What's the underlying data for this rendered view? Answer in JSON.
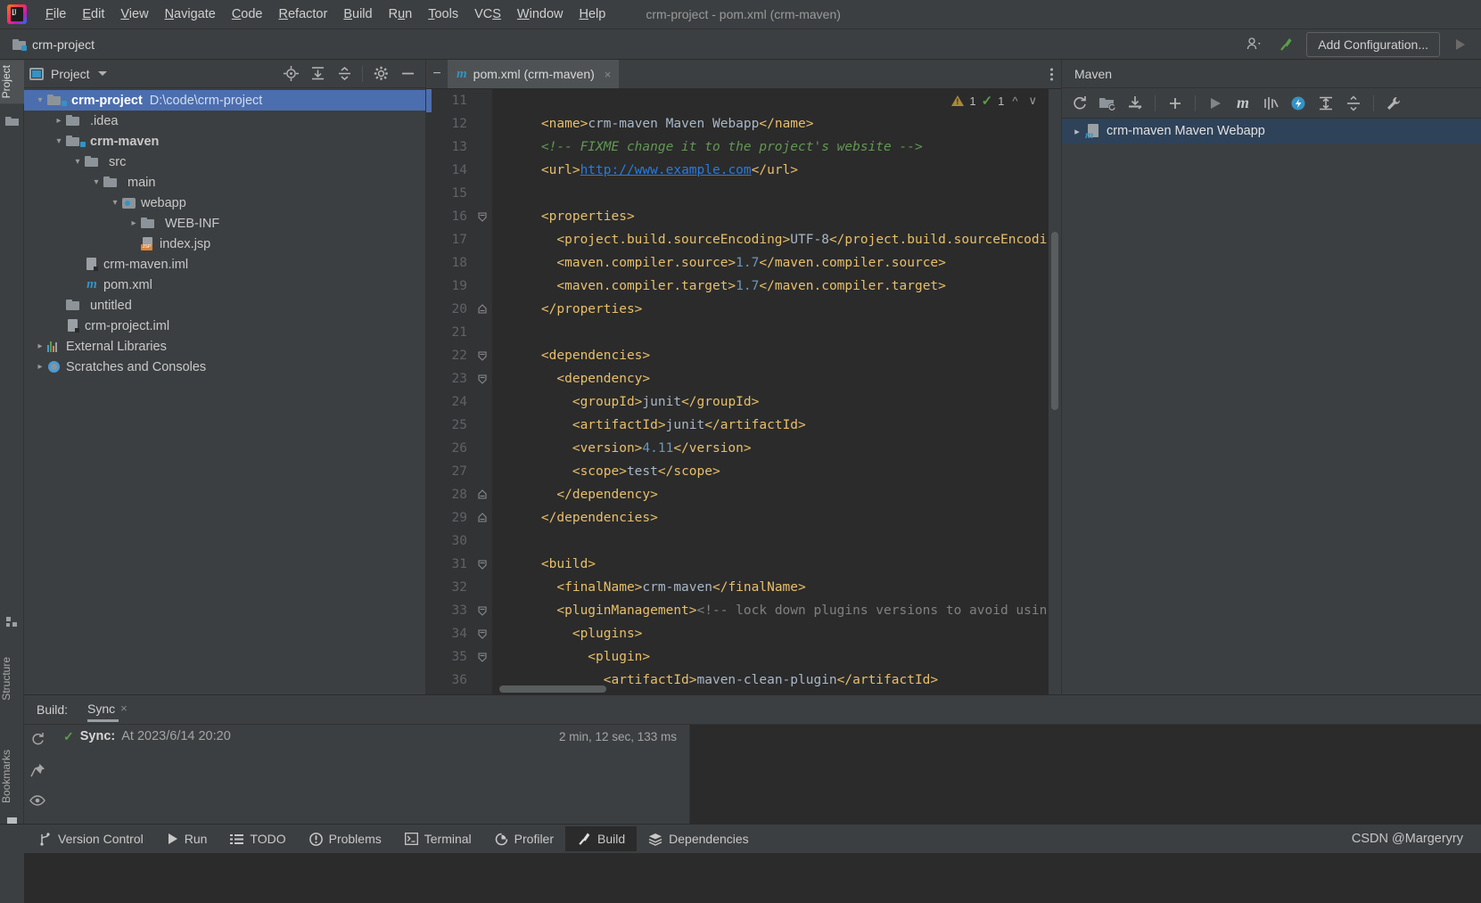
{
  "window": {
    "title": "crm-project - pom.xml (crm-maven)",
    "app_icon": "intellij-idea-logo"
  },
  "menu": {
    "items": [
      {
        "label": "File",
        "mnemonic": "F"
      },
      {
        "label": "Edit",
        "mnemonic": "E"
      },
      {
        "label": "View",
        "mnemonic": "V"
      },
      {
        "label": "Navigate",
        "mnemonic": "N"
      },
      {
        "label": "Code",
        "mnemonic": "C"
      },
      {
        "label": "Refactor",
        "mnemonic": "R"
      },
      {
        "label": "Build",
        "mnemonic": "B"
      },
      {
        "label": "Run",
        "mnemonic": "u"
      },
      {
        "label": "Tools",
        "mnemonic": "T"
      },
      {
        "label": "VCS",
        "mnemonic": "S"
      },
      {
        "label": "Window",
        "mnemonic": "W"
      },
      {
        "label": "Help",
        "mnemonic": "H"
      }
    ]
  },
  "navbar": {
    "breadcrumb": "crm-project",
    "add_configuration_label": "Add Configuration...",
    "icons": [
      "user-settings-icon",
      "hammer-build-icon",
      "run-triangle-icon"
    ]
  },
  "left_stripe": {
    "top_tabs": [
      {
        "label": "Project",
        "icon": "project-folder-icon",
        "active": true
      }
    ],
    "bottom_tabs": [
      {
        "label": "Structure",
        "icon": "structure-icon"
      },
      {
        "label": "Bookmarks",
        "icon": "bookmark-icon"
      }
    ]
  },
  "project_panel": {
    "title": "Project",
    "toolbar_icons": [
      "locate-target-icon",
      "expand-all-icon",
      "collapse-all-icon",
      "gear-icon",
      "hide-minus-icon"
    ],
    "tree": [
      {
        "indent": 0,
        "arrow": "down",
        "icon": "module-folder-icon",
        "label": "crm-project",
        "bold": true,
        "path": "D:\\code\\crm-project",
        "selected": true
      },
      {
        "indent": 1,
        "arrow": "right",
        "icon": "folder-icon",
        "label": ".idea",
        "bold": false,
        "path": "",
        "selected": false
      },
      {
        "indent": 1,
        "arrow": "down",
        "icon": "module-folder-icon",
        "label": "crm-maven",
        "bold": true,
        "path": "",
        "selected": false
      },
      {
        "indent": 2,
        "arrow": "down",
        "icon": "folder-icon",
        "label": "src",
        "bold": false,
        "path": "",
        "selected": false
      },
      {
        "indent": 3,
        "arrow": "down",
        "icon": "folder-icon",
        "label": "main",
        "bold": false,
        "path": "",
        "selected": false
      },
      {
        "indent": 4,
        "arrow": "down",
        "icon": "webapp-folder-icon",
        "label": "webapp",
        "bold": false,
        "path": "",
        "selected": false
      },
      {
        "indent": 5,
        "arrow": "right",
        "icon": "folder-icon",
        "label": "WEB-INF",
        "bold": false,
        "path": "",
        "selected": false
      },
      {
        "indent": 5,
        "arrow": "none",
        "icon": "jsp-file-icon",
        "label": "index.jsp",
        "bold": false,
        "path": "",
        "selected": false
      },
      {
        "indent": 2,
        "arrow": "none",
        "icon": "iml-file-icon",
        "label": "crm-maven.iml",
        "bold": false,
        "path": "",
        "selected": false
      },
      {
        "indent": 2,
        "arrow": "none",
        "icon": "maven-m-icon",
        "label": "pom.xml",
        "bold": false,
        "path": "",
        "selected": false
      },
      {
        "indent": 1,
        "arrow": "none",
        "icon": "folder-icon",
        "label": "untitled",
        "bold": false,
        "path": "",
        "selected": false
      },
      {
        "indent": 1,
        "arrow": "none",
        "icon": "iml-file-icon",
        "label": "crm-project.iml",
        "bold": false,
        "path": "",
        "selected": false
      },
      {
        "indent": 0,
        "arrow": "right",
        "icon": "external-libraries-icon",
        "label": "External Libraries",
        "bold": false,
        "path": "",
        "selected": false
      },
      {
        "indent": 0,
        "arrow": "right",
        "icon": "scratches-icon",
        "label": "Scratches and Consoles",
        "bold": false,
        "path": "",
        "selected": false
      }
    ]
  },
  "editor": {
    "tab": {
      "label": "pom.xml (crm-maven)",
      "icon": "maven-m-icon",
      "close": "×"
    },
    "inspection": {
      "warning_count": "1",
      "ok_count": "1",
      "warning_icon": "warning-triangle-icon",
      "ok_icon": "green-check-icon"
    },
    "lines": [
      {
        "num": "11",
        "fold": "",
        "tokens": []
      },
      {
        "num": "12",
        "fold": "",
        "tokens": [
          {
            "t": "tag",
            "v": "    <name>"
          },
          {
            "t": "txt",
            "v": "crm-maven Maven Webapp"
          },
          {
            "t": "tag",
            "v": "</name>"
          }
        ]
      },
      {
        "num": "13",
        "fold": "",
        "tokens": [
          {
            "t": "cmt",
            "v": "    <!-- FIXME change it to the project's website -->"
          }
        ]
      },
      {
        "num": "14",
        "fold": "",
        "tokens": [
          {
            "t": "tag",
            "v": "    <url>"
          },
          {
            "t": "url",
            "v": "http://www.example.com"
          },
          {
            "t": "tag",
            "v": "</url>"
          }
        ]
      },
      {
        "num": "15",
        "fold": "",
        "tokens": []
      },
      {
        "num": "16",
        "fold": "open",
        "tokens": [
          {
            "t": "tag",
            "v": "    <properties>"
          }
        ]
      },
      {
        "num": "17",
        "fold": "",
        "tokens": [
          {
            "t": "tag",
            "v": "      <project.build.sourceEncoding>"
          },
          {
            "t": "txt",
            "v": "UTF-8"
          },
          {
            "t": "tag",
            "v": "</project.build.sourceEncodi"
          }
        ]
      },
      {
        "num": "18",
        "fold": "",
        "tokens": [
          {
            "t": "tag",
            "v": "      <maven.compiler.source>"
          },
          {
            "t": "num",
            "v": "1.7"
          },
          {
            "t": "tag",
            "v": "</maven.compiler.source>"
          }
        ]
      },
      {
        "num": "19",
        "fold": "",
        "tokens": [
          {
            "t": "tag",
            "v": "      <maven.compiler.target>"
          },
          {
            "t": "num",
            "v": "1.7"
          },
          {
            "t": "tag",
            "v": "</maven.compiler.target>"
          }
        ]
      },
      {
        "num": "20",
        "fold": "close",
        "tokens": [
          {
            "t": "tag",
            "v": "    </properties>"
          }
        ]
      },
      {
        "num": "21",
        "fold": "",
        "tokens": []
      },
      {
        "num": "22",
        "fold": "open",
        "tokens": [
          {
            "t": "tag",
            "v": "    <dependencies>"
          }
        ]
      },
      {
        "num": "23",
        "fold": "open",
        "tokens": [
          {
            "t": "tag",
            "v": "      <dependency>"
          }
        ]
      },
      {
        "num": "24",
        "fold": "",
        "tokens": [
          {
            "t": "tag",
            "v": "        <groupId>"
          },
          {
            "t": "txt",
            "v": "junit"
          },
          {
            "t": "tag",
            "v": "</groupId>"
          }
        ]
      },
      {
        "num": "25",
        "fold": "",
        "tokens": [
          {
            "t": "tag",
            "v": "        <artifactId>"
          },
          {
            "t": "txt",
            "v": "junit"
          },
          {
            "t": "tag",
            "v": "</artifactId>"
          }
        ]
      },
      {
        "num": "26",
        "fold": "",
        "tokens": [
          {
            "t": "tag",
            "v": "        <version>"
          },
          {
            "t": "num",
            "v": "4.11"
          },
          {
            "t": "tag",
            "v": "</version>"
          }
        ]
      },
      {
        "num": "27",
        "fold": "",
        "tokens": [
          {
            "t": "tag",
            "v": "        <scope>"
          },
          {
            "t": "txt",
            "v": "test"
          },
          {
            "t": "tag",
            "v": "</scope>"
          }
        ]
      },
      {
        "num": "28",
        "fold": "close",
        "tokens": [
          {
            "t": "tag",
            "v": "      </dependency>"
          }
        ]
      },
      {
        "num": "29",
        "fold": "close",
        "tokens": [
          {
            "t": "tag",
            "v": "    </dependencies>"
          }
        ]
      },
      {
        "num": "30",
        "fold": "",
        "tokens": []
      },
      {
        "num": "31",
        "fold": "open",
        "tokens": [
          {
            "t": "tag",
            "v": "    <build>"
          }
        ]
      },
      {
        "num": "32",
        "fold": "",
        "tokens": [
          {
            "t": "tag",
            "v": "      <finalName>"
          },
          {
            "t": "txt",
            "v": "crm-maven"
          },
          {
            "t": "tag",
            "v": "</finalName>"
          }
        ]
      },
      {
        "num": "33",
        "fold": "open",
        "tokens": [
          {
            "t": "tag",
            "v": "      <pluginManagement>"
          },
          {
            "t": "cmt2",
            "v": "<!-- lock down plugins versions to avoid usin"
          }
        ]
      },
      {
        "num": "34",
        "fold": "open",
        "tokens": [
          {
            "t": "tag",
            "v": "        <plugins>"
          }
        ]
      },
      {
        "num": "35",
        "fold": "open",
        "tokens": [
          {
            "t": "tag",
            "v": "          <plugin>"
          }
        ]
      },
      {
        "num": "36",
        "fold": "",
        "tokens": [
          {
            "t": "tag",
            "v": "            <artifactId>"
          },
          {
            "t": "txt",
            "v": "maven-clean-plugin"
          },
          {
            "t": "tag",
            "v": "</artifactId>"
          }
        ]
      }
    ]
  },
  "maven_panel": {
    "title": "Maven",
    "toolbar_icons": [
      "reload-icon",
      "add-managed-files-icon",
      "download-sources-icon",
      "plus-icon",
      "run-icon",
      "maven-m-icon",
      "skip-tests-icon",
      "execute-goal-icon",
      "expand-all-icon",
      "collapse-all-icon",
      "settings-wrench-icon"
    ],
    "tree": [
      {
        "arrow": "right",
        "icon": "maven-project-icon",
        "label": "crm-maven Maven Webapp",
        "selected": true
      }
    ]
  },
  "build_panel": {
    "label": "Build:",
    "tab": {
      "label": "Sync",
      "close": "×"
    },
    "gutter_icons": [
      "rerun-icon",
      "pin-icon",
      "eye-icon"
    ],
    "rows": [
      {
        "status_icon": "green-check-icon",
        "title": "Sync:",
        "detail": "At 2023/6/14 20:20",
        "duration": "2 min, 12 sec, 133 ms"
      }
    ]
  },
  "status_bar": {
    "buttons": [
      {
        "label": "Version Control",
        "icon": "branch-icon",
        "active": false
      },
      {
        "label": "Run",
        "icon": "run-triangle-icon",
        "active": false
      },
      {
        "label": "TODO",
        "icon": "todo-list-icon",
        "active": false
      },
      {
        "label": "Problems",
        "icon": "problems-icon",
        "active": false
      },
      {
        "label": "Terminal",
        "icon": "terminal-icon",
        "active": false
      },
      {
        "label": "Profiler",
        "icon": "profiler-icon",
        "active": false
      },
      {
        "label": "Build",
        "icon": "hammer-build-icon",
        "active": true
      },
      {
        "label": "Dependencies",
        "icon": "dependencies-icon",
        "active": false
      }
    ],
    "watermark": "CSDN @Margeryry"
  },
  "colors": {
    "accent_blue": "#4b6eaf",
    "panel_bg": "#3c3f41",
    "editor_bg": "#2b2b2b",
    "gutter_bg": "#313335",
    "tag_color": "#e8bf6a",
    "text_color": "#a9b7c6",
    "comment_green": "#629755",
    "number_blue": "#6897bb",
    "link_blue": "#287bde",
    "maven_blue": "#3592c4",
    "check_green": "#5a9e4b"
  }
}
